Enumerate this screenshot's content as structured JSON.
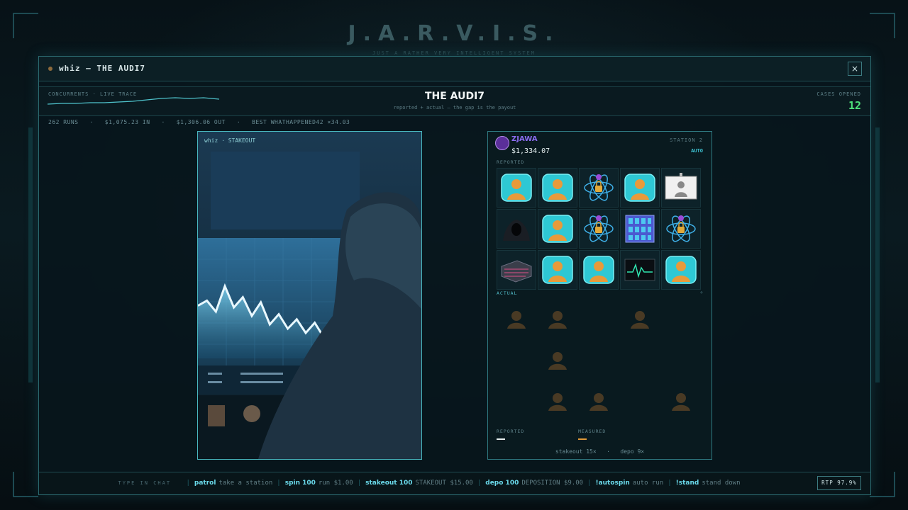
{
  "app": {
    "title": "J.A.R.V.I.S.",
    "subtitle": "JUST A RATHER VERY INTELLIGENT SYSTEM"
  },
  "window": {
    "title": "whiz — THE AUDI7",
    "close_label": "×"
  },
  "header": {
    "concurrents_label": "CONCURRENTS · LIVE TRACE",
    "title": "THE AUDI7",
    "subtitle": "reported + actual — the gap is the payout",
    "cases_label": "CASES OPENED",
    "cases_value": "12"
  },
  "stats": {
    "runs": "262 RUNS",
    "in": "$1,075.23 IN",
    "out": "$1,306.06 OUT",
    "best": "BEST WHATHAPPENED42 ×34.03"
  },
  "stakeout": {
    "label": "whiz · STAKEOUT",
    "chart_values": [
      0.62,
      0.68,
      0.55,
      0.85,
      0.6,
      0.72,
      0.5,
      0.66,
      0.4,
      0.52,
      0.35,
      0.46,
      0.3,
      0.42,
      0.25,
      0.33
    ]
  },
  "station": {
    "player": "ZJAWA",
    "balance": "$1,334.07",
    "station_label": "STATION 2",
    "mode": "AUTO",
    "reported_label": "REPORTED",
    "actual_label": "ACTUAL",
    "divider_mark": "÷",
    "reported_grid": [
      [
        "person",
        "person",
        "atom",
        "person",
        "id-card"
      ],
      [
        "hacker",
        "person",
        "atom",
        "server",
        "atom"
      ],
      [
        "rack",
        "person",
        "person",
        "monitor",
        "person"
      ]
    ],
    "actual_grid": [
      [
        "ghost",
        "ghost",
        "empty",
        "ghost",
        "empty"
      ],
      [
        "empty",
        "ghost",
        "empty",
        "empty",
        "empty"
      ],
      [
        "empty",
        "ghost",
        "ghost",
        "empty",
        "ghost"
      ]
    ],
    "legend_reported": "REPORTED",
    "legend_measured": "MEASURED",
    "stakeout_count": "stakeout 15×",
    "depo_count": "depo 9×"
  },
  "footer": {
    "chat_label": "TYPE IN CHAT",
    "commands": [
      {
        "cmd": "patrol",
        "desc": "take a station"
      },
      {
        "cmd": "spin 100",
        "desc": "run $1.00"
      },
      {
        "cmd": "stakeout 100",
        "desc": "STAKEOUT $15.00"
      },
      {
        "cmd": "depo 100",
        "desc": "DEPOSITION $9.00"
      },
      {
        "cmd": "!autospin",
        "desc": "auto run"
      },
      {
        "cmd": "!stand",
        "desc": "stand down"
      }
    ],
    "rtp": "RTP 97.9%"
  },
  "colors": {
    "accent": "#3fc6d6",
    "cases": "#4ee07a",
    "player": "#8b6cf0",
    "measured": "#e09a3a"
  }
}
